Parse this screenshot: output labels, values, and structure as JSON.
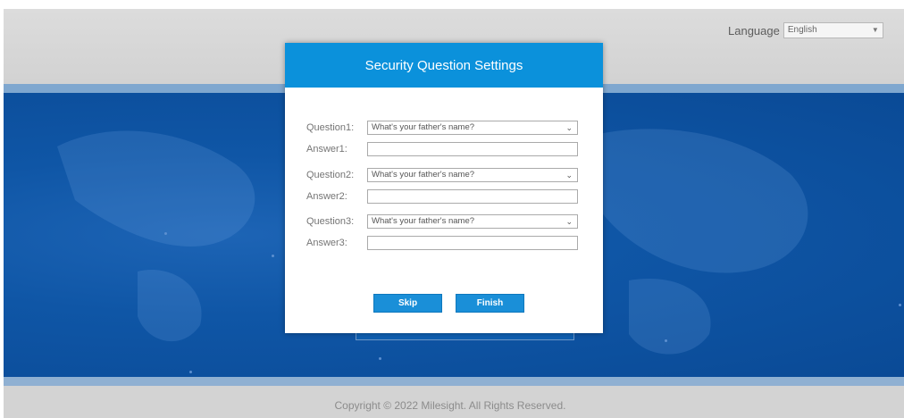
{
  "header": {
    "language_label": "Language",
    "language_value": "English"
  },
  "dialog": {
    "title": "Security Question Settings",
    "rows": [
      {
        "question_label": "Question1:",
        "question_value": "What's your father's name?",
        "answer_label": "Answer1:",
        "answer_value": ""
      },
      {
        "question_label": "Question2:",
        "question_value": "What's your father's name?",
        "answer_label": "Answer2:",
        "answer_value": ""
      },
      {
        "question_label": "Question3:",
        "question_value": "What's your father's name?",
        "answer_label": "Answer3:",
        "answer_value": ""
      }
    ],
    "skip_label": "Skip",
    "finish_label": "Finish"
  },
  "footer": {
    "copyright": "Copyright © 2022 Milesight. All Rights Reserved."
  },
  "colors": {
    "dialog_header": "#0b91db",
    "button": "#1a8fd8",
    "background_blue": "#0f56a6"
  },
  "icons": {
    "select_arrow": "chevron-down-icon"
  }
}
